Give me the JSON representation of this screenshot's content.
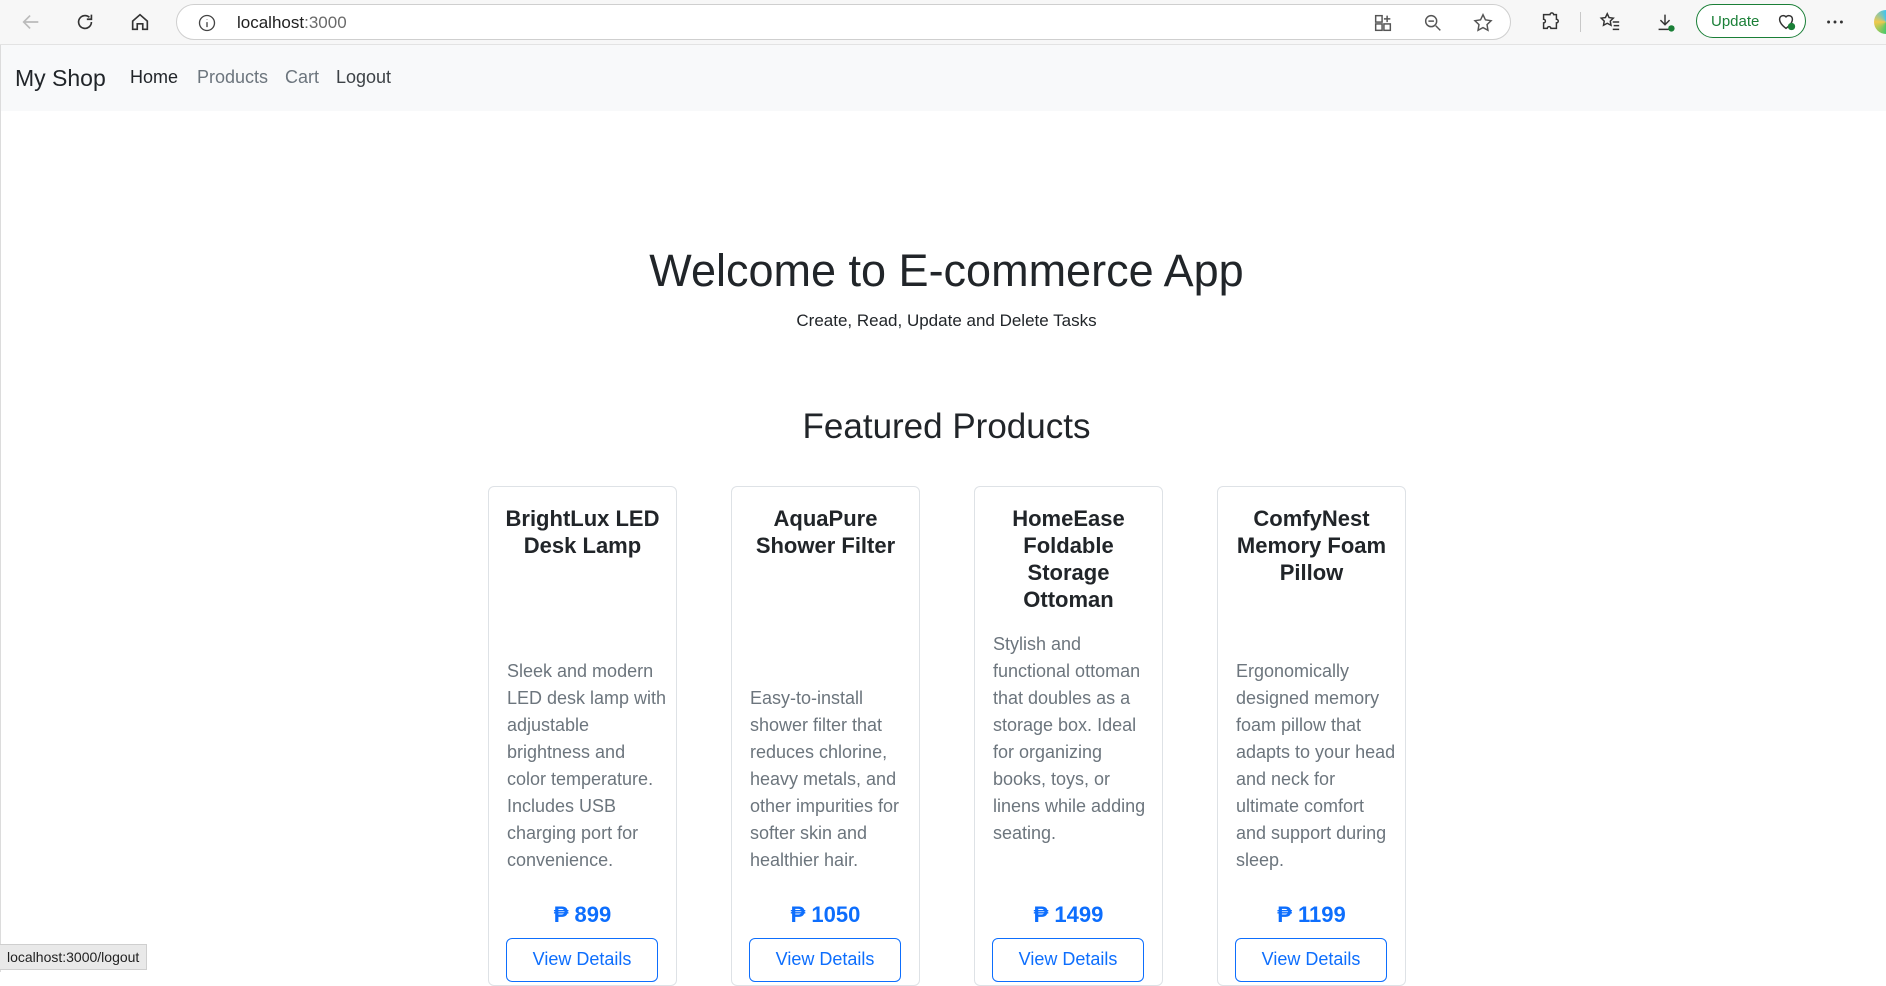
{
  "browser": {
    "url_host": "localhost",
    "url_port": ":3000",
    "update_label": "Update",
    "status_url": "localhost:3000/logout"
  },
  "nav": {
    "brand": "My Shop",
    "links": [
      {
        "label": "Home",
        "active": true
      },
      {
        "label": "Products",
        "active": false
      },
      {
        "label": "Cart",
        "active": false
      },
      {
        "label": "Logout",
        "active": false
      }
    ]
  },
  "hero": {
    "title": "Welcome to E-commerce App",
    "subtitle": "Create, Read, Update and Delete Tasks"
  },
  "featured": {
    "title": "Featured Products",
    "products": [
      {
        "name": "BrightLux LED Desk Lamp",
        "description": "Sleek and modern LED desk lamp with adjustable brightness and color temperature. Includes USB charging port for convenience.",
        "price": "₱ 899",
        "button": "View Details"
      },
      {
        "name": "AquaPure Shower Filter",
        "description": "Easy-to-install shower filter that reduces chlorine, heavy metals, and other impurities for softer skin and healthier hair.",
        "price": "₱ 1050",
        "button": "View Details"
      },
      {
        "name": "HomeEase Foldable Storage Ottoman",
        "description": "Stylish and functional ottoman that doubles as a storage box. Ideal for organizing books, toys, or linens while adding seating.",
        "price": "₱ 1499",
        "button": "View Details"
      },
      {
        "name": "ComfyNest Memory Foam Pillow",
        "description": "Ergonomically designed memory foam pillow that adapts to your head and neck for ultimate comfort and support during sleep.",
        "price": "₱ 1199",
        "button": "View Details"
      }
    ]
  },
  "colors": {
    "accent": "#0d6efd",
    "navbar_bg": "#f8f9fa",
    "muted_text": "#6c757d"
  }
}
